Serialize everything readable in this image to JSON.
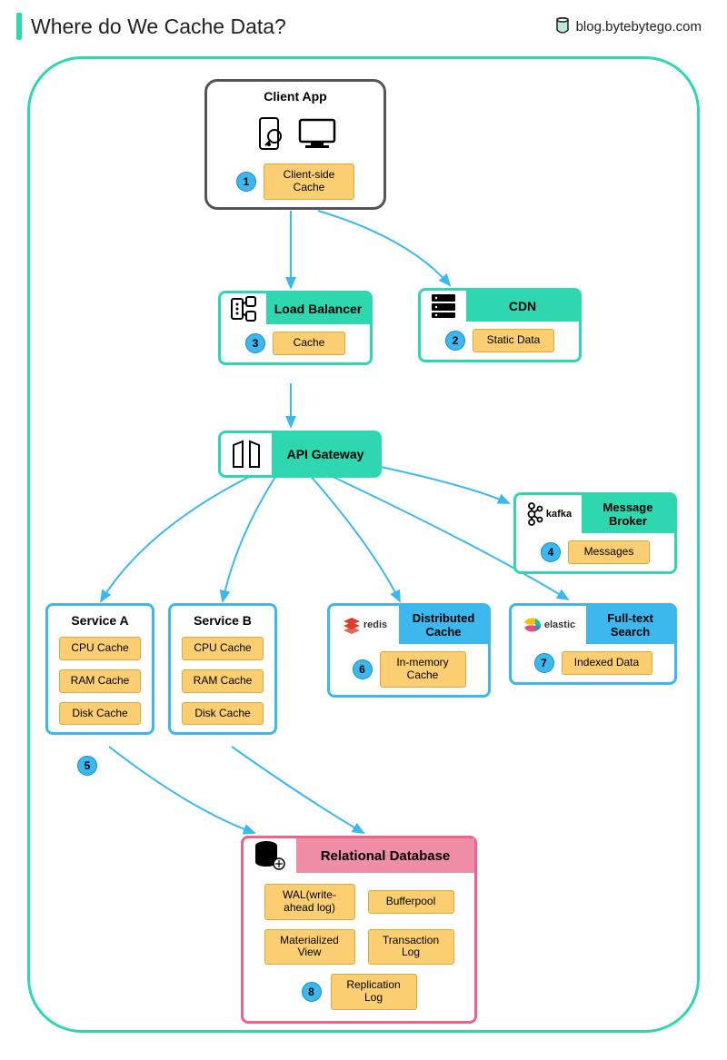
{
  "header": {
    "title": "Where do We Cache Data?",
    "site": "blog.bytebytego.com"
  },
  "nodes": {
    "client": {
      "title": "Client App",
      "badge_num": "1",
      "badge_label": "Client-side Cache"
    },
    "lb": {
      "title": "Load Balancer",
      "badge_num": "3",
      "badge_label": "Cache"
    },
    "cdn": {
      "title": "CDN",
      "badge_num": "2",
      "badge_label": "Static Data"
    },
    "gw": {
      "title": "API Gateway"
    },
    "broker": {
      "title": "Message Broker",
      "logo": "kafka",
      "badge_num": "4",
      "badge_label": "Messages"
    },
    "svcA": {
      "title": "Service A",
      "items": [
        "CPU Cache",
        "RAM Cache",
        "Disk Cache"
      ]
    },
    "svcB": {
      "title": "Service B",
      "items": [
        "CPU Cache",
        "RAM Cache",
        "Disk Cache"
      ]
    },
    "svc_num": "5",
    "dist": {
      "title": "Distributed Cache",
      "logo": "redis",
      "badge_num": "6",
      "badge_label": "In-memory Cache"
    },
    "search": {
      "title": "Full-text Search",
      "logo": "elastic",
      "badge_num": "7",
      "badge_label": "Indexed Data"
    },
    "db": {
      "title": "Relational Database",
      "badge_num": "8",
      "items": [
        "WAL(write-ahead log)",
        "Bufferpool",
        "Materialized View",
        "Transaction Log",
        "Replication Log"
      ]
    }
  }
}
